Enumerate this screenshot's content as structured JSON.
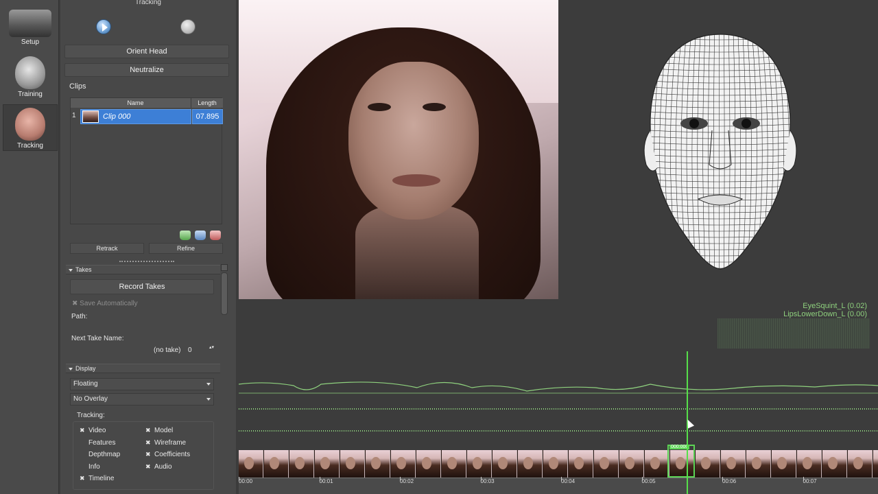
{
  "nav": {
    "items": [
      {
        "label": "Setup"
      },
      {
        "label": "Training"
      },
      {
        "label": "Tracking"
      }
    ]
  },
  "panel": {
    "title": "Tracking",
    "orient_label": "Orient Head",
    "neutralize_label": "Neutralize",
    "clips_label": "Clips",
    "clips_columns": [
      "Name",
      "Length"
    ],
    "clips": [
      {
        "index": "1",
        "name": "Clip 000",
        "length": "07.895"
      }
    ],
    "retrack_label": "Retrack",
    "refine_label": "Refine",
    "takes_header": "Takes",
    "record_takes_label": "Record Takes",
    "save_auto_label": "Save Automatically",
    "path_label": "Path:",
    "next_take_label": "Next Take Name:",
    "take_value": "(no take)",
    "take_number": "0",
    "display_header": "Display",
    "display_mode": "Floating",
    "overlay_mode": "No Overlay",
    "tracking_label": "Tracking:",
    "options": [
      {
        "label": "Video",
        "checked": true
      },
      {
        "label": "Model",
        "checked": true
      },
      {
        "label": "Features",
        "checked": false
      },
      {
        "label": "Wireframe",
        "checked": true
      },
      {
        "label": "Depthmap",
        "checked": false
      },
      {
        "label": "Coefficients",
        "checked": true
      },
      {
        "label": "Info",
        "checked": false
      },
      {
        "label": "Audio",
        "checked": true
      },
      {
        "label": "Timeline",
        "checked": true
      }
    ]
  },
  "legend": {
    "line1": "EyeSquint_L (0.02)",
    "line2": "LipsLowerDown_L (0.00)"
  },
  "timeline": {
    "ticks": [
      "00:00",
      "00:01",
      "00:02",
      "00:03",
      "00:04",
      "00:05",
      "00:06",
      "00:07"
    ],
    "selected_frame_label": "000:000"
  },
  "colors": {
    "accent": "#3d7fd6",
    "curve": "#8fd27e",
    "playhead": "#56e04a"
  }
}
